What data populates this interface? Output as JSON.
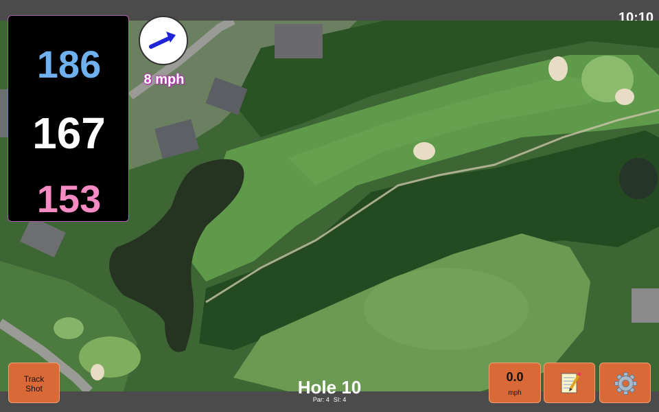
{
  "status_bar": {
    "time": "10:10"
  },
  "distances": {
    "back": "186",
    "middle": "167",
    "front": "153"
  },
  "wind": {
    "speed_label": "8 mph",
    "arrow_icon": "arrow-icon"
  },
  "hole": {
    "title": "Hole 10",
    "par": "Par: 4",
    "si": "SI: 4"
  },
  "buttons": {
    "track_shot_line1": "Track",
    "track_shot_line2": "Shot",
    "wind_value": "0.0",
    "wind_unit": "mph",
    "notes_icon": "notepad-icon",
    "settings_icon": "gear-icon"
  },
  "colors": {
    "back_distance": "#6fb1ee",
    "middle_distance": "#ffffff",
    "front_distance": "#f58bc3",
    "button": "#d96a37"
  }
}
